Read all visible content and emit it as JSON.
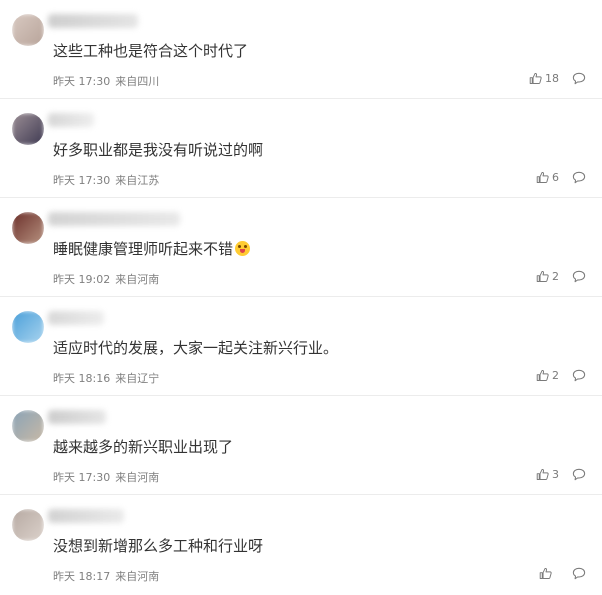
{
  "comments": [
    {
      "text": "这些工种也是符合这个时代了",
      "time": "昨天 17:30",
      "location": "来自四川",
      "likes": "18",
      "avatar_colors": [
        "#d8c9c1",
        "#b8a49a"
      ],
      "name_colors": [
        "#c9c9c9",
        "#e2e2e2"
      ]
    },
    {
      "text": "好多职业都是我没有听说过的啊",
      "time": "昨天 17:30",
      "location": "来自江苏",
      "likes": "6",
      "avatar_colors": [
        "#9b8e95",
        "#3f3a52"
      ],
      "name_colors": [
        "#d2d2d2",
        "#ececec"
      ]
    },
    {
      "text": "睡眠健康管理师听起来不错",
      "emoji": "face-with-tongue-emoji",
      "time": "昨天 19:02",
      "location": "来自河南",
      "likes": "2",
      "avatar_colors": [
        "#6b2f2a",
        "#b79280"
      ],
      "name_colors": [
        "#cfcfcf",
        "#e6e6e6"
      ]
    },
    {
      "text": "适应时代的发展，大家一起关注新兴行业。",
      "time": "昨天 18:16",
      "location": "来自辽宁",
      "likes": "2",
      "avatar_colors": [
        "#4a9fd9",
        "#a9d4ef"
      ],
      "name_colors": [
        "#d4d4d4",
        "#ebebeb"
      ]
    },
    {
      "text": "越来越多的新兴职业出现了",
      "time": "昨天 17:30",
      "location": "来自河南",
      "likes": "3",
      "avatar_colors": [
        "#8aa3b6",
        "#c8b9a6"
      ],
      "name_colors": [
        "#c7c7c7",
        "#e3e3e3"
      ]
    },
    {
      "text": "没想到新增那么多工种和行业呀",
      "time": "昨天 18:17",
      "location": "来自河南",
      "likes": "",
      "avatar_colors": [
        "#b6a9a2",
        "#dcd2cb"
      ],
      "name_colors": [
        "#cdcdcd",
        "#e8e8e8"
      ]
    }
  ],
  "icons": {
    "like": "thumbs-up-icon",
    "reply": "speech-bubble-icon"
  }
}
